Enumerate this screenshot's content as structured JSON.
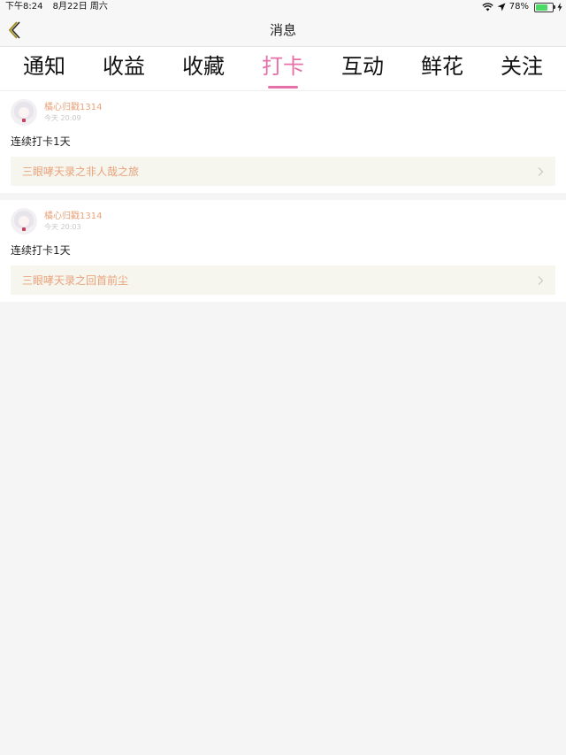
{
  "statusbar": {
    "time": "下午8:24",
    "date": "8月22日 周六",
    "battery": "78%",
    "battery_level": 0.78,
    "icons": [
      "wifi-icon",
      "location-arrow-icon",
      "battery-icon",
      "charging-icon"
    ]
  },
  "navbar": {
    "title": "消息",
    "back_icon": "chevron-left-icon"
  },
  "tabs": [
    {
      "label": "通知",
      "active": false
    },
    {
      "label": "收益",
      "active": false
    },
    {
      "label": "收藏",
      "active": false
    },
    {
      "label": "打卡",
      "active": true
    },
    {
      "label": "互动",
      "active": false
    },
    {
      "label": "鲜花",
      "active": false
    },
    {
      "label": "关注",
      "active": false
    }
  ],
  "colors": {
    "accent": "#e870a8",
    "username": "#e8a27a",
    "link_bg": "#f6f5ee",
    "page_bg": "#f5f5f5",
    "back_icon": "#a5911b"
  },
  "items": [
    {
      "username": "橘心归戳1314",
      "time": "今天 20:09",
      "content": "连续打卡1天",
      "link_title": "三眼哮天录之非人哉之旅"
    },
    {
      "username": "橘心归戳1314",
      "time": "今天 20:03",
      "content": "连续打卡1天",
      "link_title": "三眼哮天录之回首前尘"
    }
  ]
}
